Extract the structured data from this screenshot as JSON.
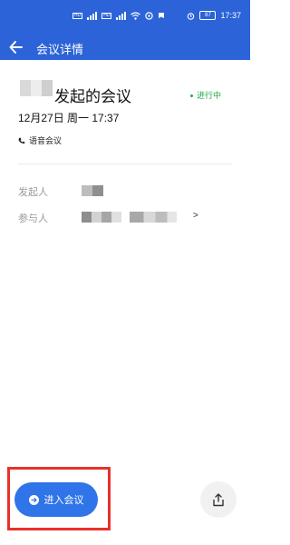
{
  "status_bar": {
    "time": "17:37",
    "battery_level": "87",
    "network_badges": [
      "HD",
      "4G",
      "HD",
      "4G"
    ],
    "icons": [
      "signal-icon",
      "wifi-icon",
      "alarm-icon",
      "battery-icon"
    ]
  },
  "app_bar": {
    "title": "会议详情",
    "back_icon": "arrow-left-icon"
  },
  "meeting": {
    "title_suffix": "发起的会议",
    "status": "进行中",
    "datetime": "12月27日 周一 17:37",
    "type": "语音会议",
    "status_color": "#22a848"
  },
  "details": {
    "organizer_label": "发起人",
    "participants_label": "参与人",
    "participants_chevron": ">"
  },
  "actions": {
    "join_label": "进入会议",
    "share_icon": "share-icon"
  },
  "colors": {
    "brand": "#2c63d8",
    "join_button": "#2f74e8",
    "highlight": "#e8312c"
  }
}
